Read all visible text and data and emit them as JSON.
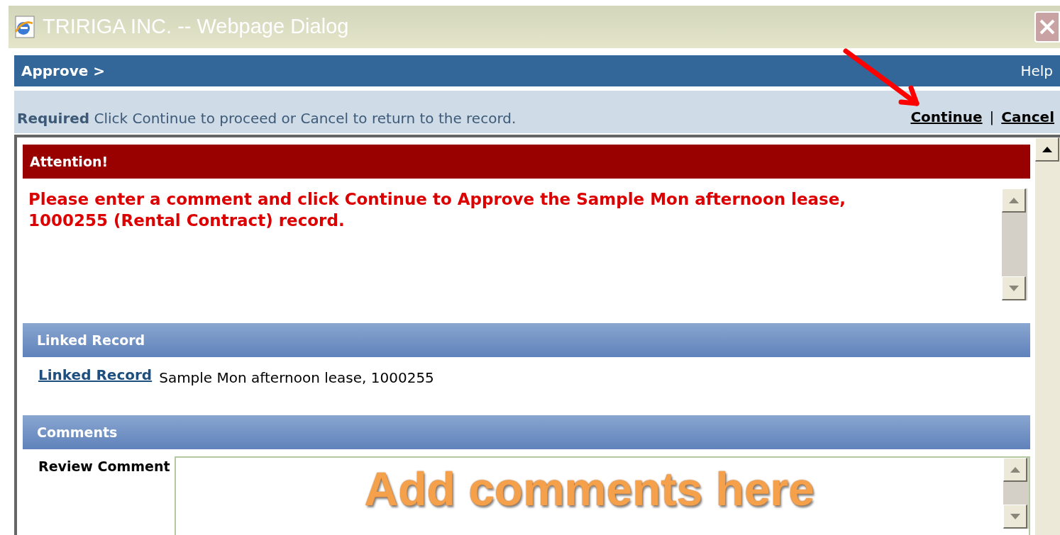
{
  "window": {
    "title": "TRIRIGA INC. -- Webpage Dialog"
  },
  "header": {
    "breadcrumb": "Approve >",
    "help": "Help"
  },
  "instruction": {
    "text": "**Required** Click Continue to proceed or Cancel to return to the record.",
    "actions": [
      "Continue",
      "Cancel"
    ],
    "separator": "|"
  },
  "attention": {
    "title": "Attention!",
    "message": "Please enter a comment and click Continue to Approve the Sample Mon afternoon lease, 1000255 (Rental Contract) record."
  },
  "linked_record": {
    "title": "Linked Record",
    "link": "Linked Record",
    "value": "Sample Mon afternoon lease, 1000255"
  },
  "comments": {
    "title": "Comments",
    "label": "Review Comment",
    "annotation": "Add comments here"
  }
}
